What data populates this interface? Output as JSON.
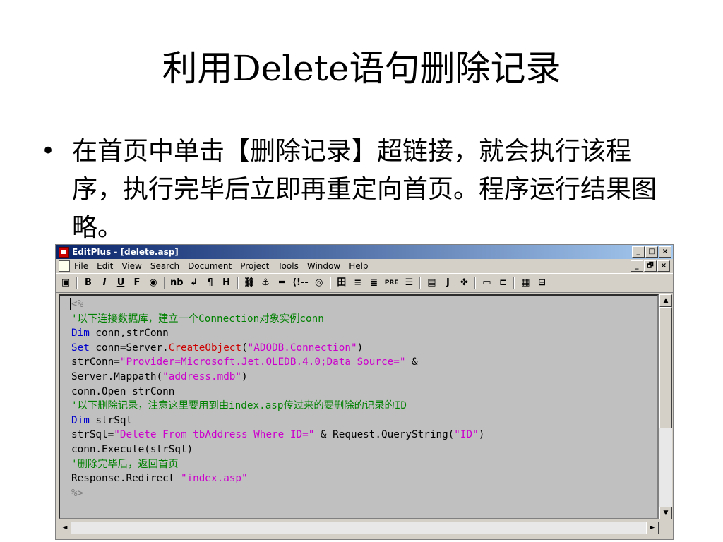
{
  "slide": {
    "title": "利用Delete语句删除记录",
    "bullet": "在首页中单击【删除记录】超链接，就会执行该程序，执行完毕后立即再重定向首页。程序运行结果图略。"
  },
  "window": {
    "title": "EditPlus - [delete.asp]",
    "controls": [
      "_",
      "□",
      "×"
    ],
    "mdi_controls": [
      "_",
      "🗗",
      "×"
    ]
  },
  "menu": [
    "File",
    "Edit",
    "View",
    "Search",
    "Document",
    "Project",
    "Tools",
    "Window",
    "Help"
  ],
  "toolbar": [
    "B",
    "I",
    "U",
    "F",
    "nb",
    "↲",
    "¶",
    "H",
    "⚓",
    "═",
    "⟨!--",
    "田",
    "≡",
    "≣",
    "PRE",
    "☰",
    "J"
  ],
  "code": [
    [
      {
        "t": "<%",
        "c": "asp"
      }
    ],
    [
      {
        "t": "'以下连接数据库，建立一个Connection对象实例conn",
        "c": "comment"
      }
    ],
    [
      {
        "t": "Dim",
        "c": "keyword"
      },
      {
        "t": " conn,strConn",
        "c": "def"
      }
    ],
    [
      {
        "t": "Set",
        "c": "keyword"
      },
      {
        "t": " conn=Server.",
        "c": "def"
      },
      {
        "t": "CreateObject",
        "c": "func"
      },
      {
        "t": "(",
        "c": "def"
      },
      {
        "t": "\"ADODB.Connection\"",
        "c": "string"
      },
      {
        "t": ")",
        "c": "def"
      }
    ],
    [
      {
        "t": "strConn=",
        "c": "def"
      },
      {
        "t": "\"Provider=Microsoft.Jet.OLEDB.4.0;Data Source=\"",
        "c": "string"
      },
      {
        "t": " &",
        "c": "def"
      }
    ],
    [
      {
        "t": "Server.Mappath(",
        "c": "def"
      },
      {
        "t": "\"address.mdb\"",
        "c": "string"
      },
      {
        "t": ")",
        "c": "def"
      }
    ],
    [
      {
        "t": "conn.Open strConn",
        "c": "def"
      }
    ],
    [
      {
        "t": "'以下删除记录，注意这里要用到由index.asp传过来的要删除的记录的ID",
        "c": "comment"
      }
    ],
    [
      {
        "t": "Dim",
        "c": "keyword"
      },
      {
        "t": " strSql",
        "c": "def"
      }
    ],
    [
      {
        "t": "strSql=",
        "c": "def"
      },
      {
        "t": "\"Delete From tbAddress Where ID=\"",
        "c": "string"
      },
      {
        "t": " & Request.QueryString(",
        "c": "def"
      },
      {
        "t": "\"ID\"",
        "c": "string"
      },
      {
        "t": ")",
        "c": "def"
      }
    ],
    [
      {
        "t": "conn.Execute(strSql)",
        "c": "def"
      }
    ],
    [
      {
        "t": "'删除完毕后，返回首页",
        "c": "comment"
      }
    ],
    [
      {
        "t": "Response.Redirect ",
        "c": "def"
      },
      {
        "t": "\"index.asp\"",
        "c": "string"
      }
    ],
    [
      {
        "t": "%>",
        "c": "asp"
      }
    ]
  ],
  "scrollbar": {
    "up": "▲",
    "down": "▼",
    "left": "◄",
    "right": "►"
  }
}
